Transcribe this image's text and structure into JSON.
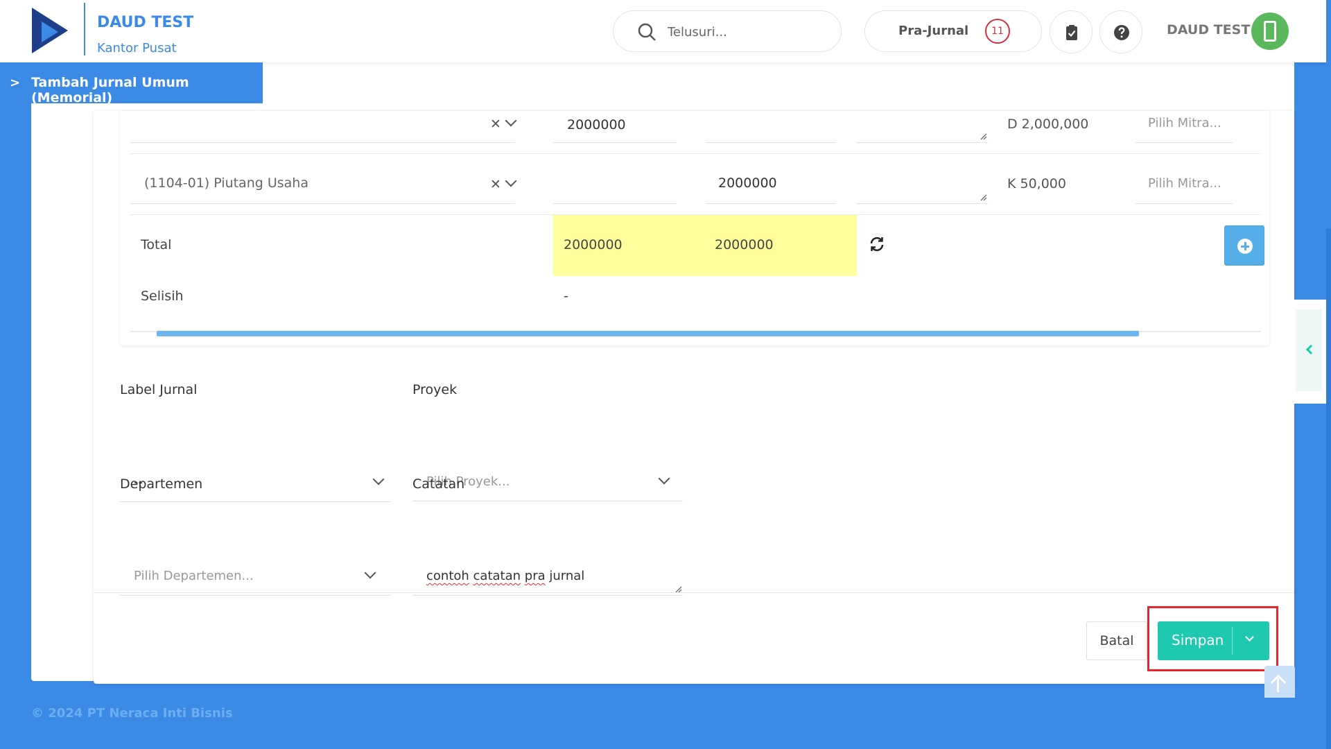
{
  "header": {
    "company": "DAUD TEST",
    "office": "Kantor Pusat",
    "search_placeholder": "Telusuri...",
    "prajurnal_label": "Pra-Jurnal",
    "prajurnal_count": "11",
    "user_name": "DAUD TEST"
  },
  "page_tab": {
    "title": "Tambah Jurnal Umum (Memorial)"
  },
  "journal": {
    "rows": [
      {
        "account": "",
        "debit": "2000000",
        "credit": "",
        "balance": "D 2,000,000",
        "mitra_placeholder": "Pilih Mitra..."
      },
      {
        "account": "(1104-01) Piutang Usaha",
        "debit": "",
        "credit": "2000000",
        "balance": "K 50,000",
        "mitra_placeholder": "Pilih Mitra..."
      }
    ],
    "total_label": "Total",
    "total_debit": "2000000",
    "total_credit": "2000000",
    "selisih_label": "Selisih",
    "selisih_value": "-"
  },
  "form": {
    "label_jurnal": {
      "label": "Label Jurnal",
      "value": "--"
    },
    "proyek": {
      "label": "Proyek",
      "placeholder": "Pilih Proyek..."
    },
    "departemen": {
      "label": "Departemen",
      "placeholder": "Pilih Departemen..."
    },
    "catatan": {
      "label": "Catatan",
      "words": [
        "contoh",
        "catatan",
        "pra",
        "jurnal"
      ]
    }
  },
  "actions": {
    "cancel": "Batal",
    "save": "Simpan"
  },
  "footer": {
    "copyright": "© 2024 PT Neraca Inti Bisnis"
  },
  "colors": {
    "primary": "#3b8ae6",
    "success": "#1fc9b0",
    "danger": "#e8252f",
    "highlight": "#ffff9e"
  }
}
